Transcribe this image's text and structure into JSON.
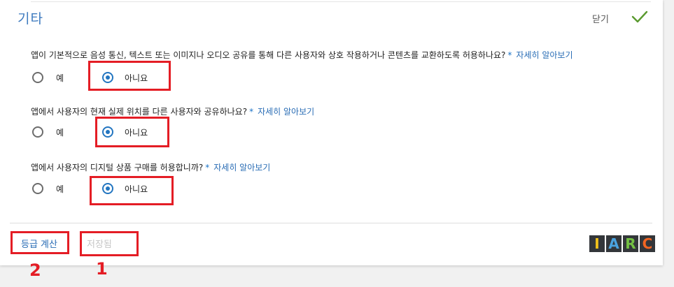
{
  "section": {
    "title": "기타",
    "close_label": "닫기"
  },
  "questions": [
    {
      "text": "앱이 기본적으로 음성 통신, 텍스트 또는 이미지나 오디오 공유를 통해 다른 사용자와 상호 작용하거나 콘텐츠를 교환하도록 허용하나요?",
      "required_mark": "*",
      "learn_more": "자세히 알아보기",
      "options": [
        "예",
        "아니요"
      ],
      "selected": "아니요"
    },
    {
      "text": "앱에서 사용자의 현재 실제 위치를 다른 사용자와 공유하나요?",
      "required_mark": "*",
      "learn_more": "자세히 알아보기",
      "options": [
        "예",
        "아니요"
      ],
      "selected": "아니요"
    },
    {
      "text": "앱에서 사용자의 디지털 상품 구매를 허용합니까?",
      "required_mark": "*",
      "learn_more": "자세히 알아보기",
      "options": [
        "예",
        "아니요"
      ],
      "selected": "아니요"
    }
  ],
  "footer": {
    "calc_label": "등급 계산",
    "saved_label": "저장됨",
    "logo_letters": [
      "I",
      "A",
      "R",
      "C"
    ],
    "logo_colors": [
      "#f2c21b",
      "#4aa3e0",
      "#74c043",
      "#f26522"
    ]
  },
  "annotations": {
    "num_calc": "2",
    "num_saved": "1"
  },
  "colors": {
    "accent": "#2275c0",
    "highlight": "#e41d25",
    "check": "#5a9a2f"
  }
}
